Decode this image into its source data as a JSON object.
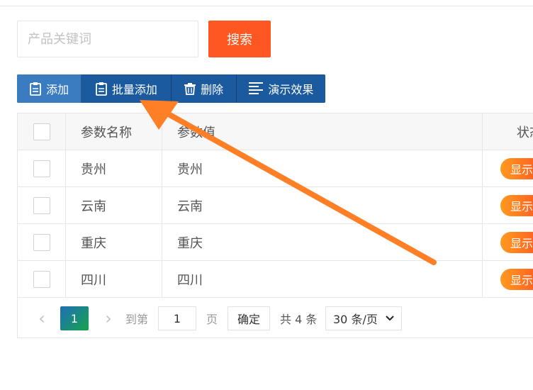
{
  "search": {
    "placeholder": "产品关键词",
    "button": "搜索"
  },
  "toolbar": {
    "add": "添加",
    "batch_add": "批量添加",
    "delete": "删除",
    "demo": "演示效果"
  },
  "table": {
    "columns": [
      "参数名称",
      "参数值",
      "状态"
    ],
    "rows": [
      {
        "name": "贵州",
        "value": "贵州",
        "status": "显示"
      },
      {
        "name": "云南",
        "value": "云南",
        "status": "显示"
      },
      {
        "name": "重庆",
        "value": "重庆",
        "status": "显示"
      },
      {
        "name": "四川",
        "value": "四川",
        "status": "显示"
      }
    ]
  },
  "pagination": {
    "current_page": "1",
    "goto_label": "到第",
    "goto_value": "1",
    "page_unit": "页",
    "confirm": "确定",
    "total": "共 4 条",
    "page_size": "30 条/页"
  },
  "colors": {
    "accent": "#ff5722",
    "toolbar": "#1e5fa8",
    "badge_from": "#ff9a1f",
    "badge_to": "#ff5722",
    "annotation_arrow": "#ff7f27"
  }
}
